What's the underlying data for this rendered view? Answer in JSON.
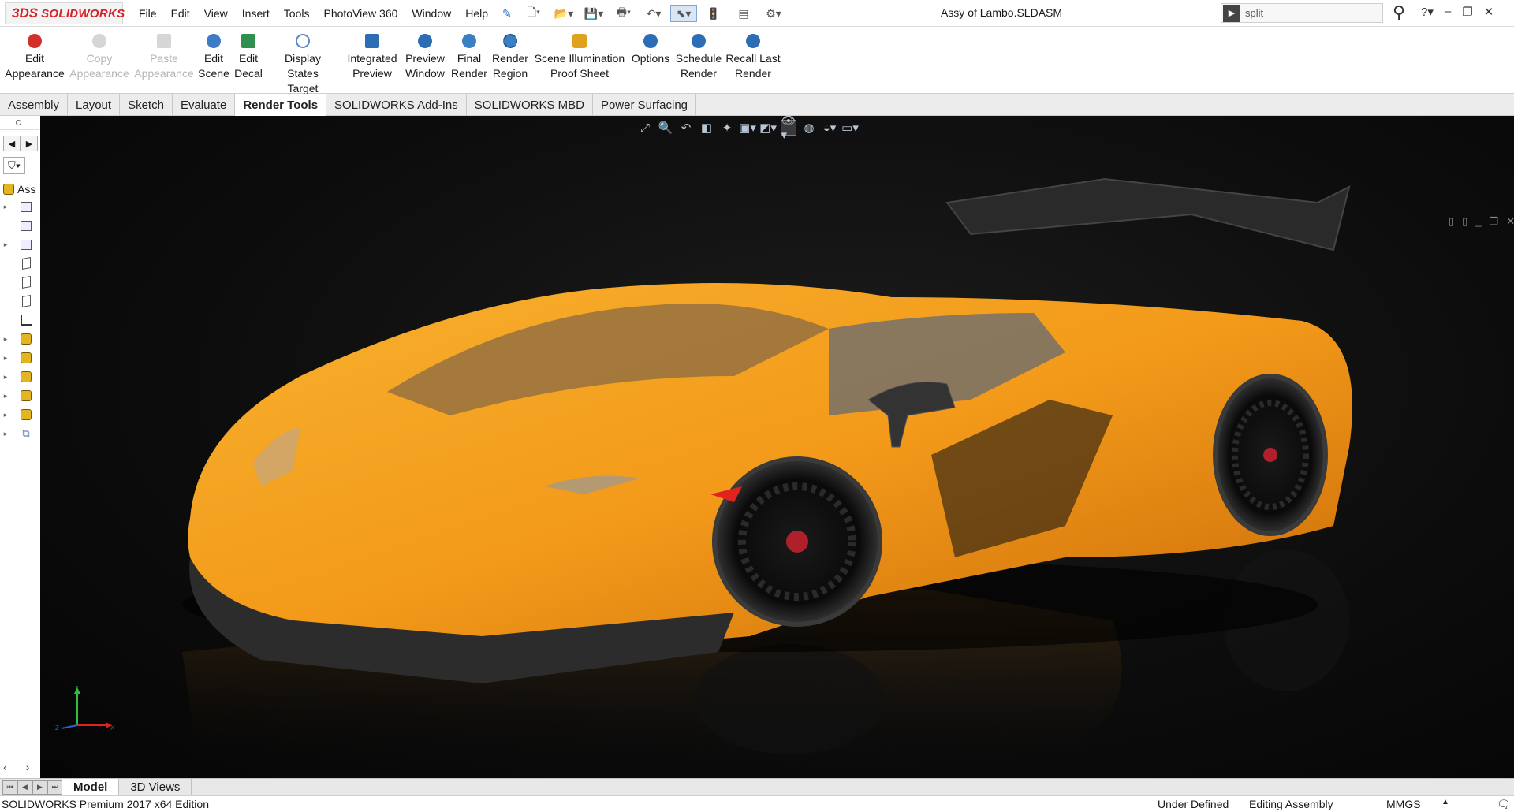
{
  "app": {
    "brand_mark": "3DS",
    "brand_name": "SOLIDWORKS",
    "document_title": "Assy of Lambo.SLDASM"
  },
  "menu": [
    "File",
    "Edit",
    "View",
    "Insert",
    "Tools",
    "PhotoView 360",
    "Window",
    "Help"
  ],
  "search": {
    "value": "split"
  },
  "ribbon": [
    {
      "label1": "Edit",
      "label2": "Appearance",
      "enabled": true,
      "color": "#d2302a"
    },
    {
      "label1": "Copy",
      "label2": "Appearance",
      "enabled": false,
      "color": "#c9c9c9"
    },
    {
      "label1": "Paste",
      "label2": "Appearance",
      "enabled": false,
      "color": "#c9c9c9"
    },
    {
      "label1": "Edit",
      "label2": "Scene",
      "enabled": true,
      "color": "#3e7bc7"
    },
    {
      "label1": "Edit",
      "label2": "Decal",
      "enabled": true,
      "color": "#2f8f4e"
    },
    {
      "label1": "Display States",
      "label2": "Target",
      "enabled": true,
      "color": "#5a88c8"
    },
    {
      "label1": "Integrated",
      "label2": "Preview",
      "enabled": true,
      "color": "#2c6db5"
    },
    {
      "label1": "Preview",
      "label2": "Window",
      "enabled": true,
      "color": "#2c6db5"
    },
    {
      "label1": "Final",
      "label2": "Render",
      "enabled": true,
      "color": "#3a7fc4"
    },
    {
      "label1": "Render",
      "label2": "Region",
      "enabled": true,
      "color": "#3a7fc4"
    },
    {
      "label1": "Scene Illumination",
      "label2": "Proof Sheet",
      "enabled": true,
      "color": "#e0a21c"
    },
    {
      "label1": "Options",
      "label2": "",
      "enabled": true,
      "color": "#2c6db5"
    },
    {
      "label1": "Schedule",
      "label2": "Render",
      "enabled": true,
      "color": "#2c6db5"
    },
    {
      "label1": "Recall Last",
      "label2": "Render",
      "enabled": true,
      "color": "#2c6db5"
    }
  ],
  "tabs": [
    "Assembly",
    "Layout",
    "Sketch",
    "Evaluate",
    "Render Tools",
    "SOLIDWORKS Add-Ins",
    "SOLIDWORKS MBD",
    "Power Surfacing"
  ],
  "active_tab": "Render Tools",
  "feature_tree": {
    "root_label": "Ass"
  },
  "bottom_tabs": [
    "Model",
    "3D Views"
  ],
  "status": {
    "edition": "SOLIDWORKS Premium 2017 x64 Edition",
    "state": "Under Defined",
    "mode": "Editing Assembly",
    "units": "MMGS"
  },
  "colors": {
    "car_body": "#f39a1a",
    "background": "#0b0b0b",
    "brand": "#d4232a"
  }
}
